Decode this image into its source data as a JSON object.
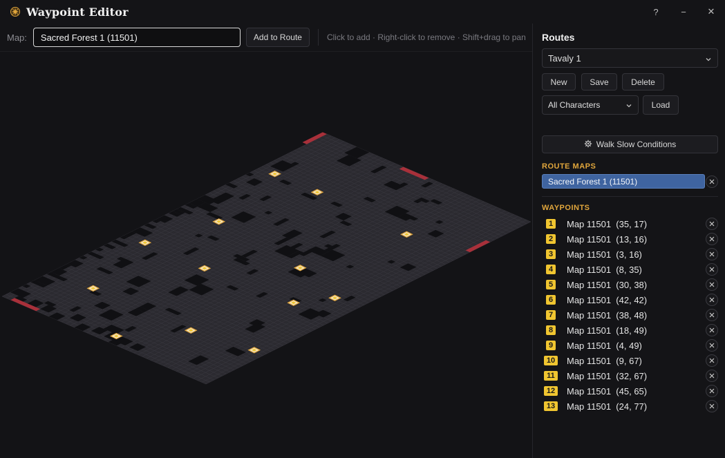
{
  "app": {
    "title": "Waypoint Editor"
  },
  "window": {
    "help": "?",
    "minimize": "−",
    "close": "✕"
  },
  "toolbar": {
    "map_label": "Map:",
    "map_value": "Sacred Forest 1 (11501)",
    "add_to_route": "Add to Route",
    "hint": "Click to add · Right-click to remove · Shift+drag to pan"
  },
  "routes": {
    "title": "Routes",
    "selected": "Tavaly 1",
    "new": "New",
    "save": "Save",
    "delete": "Delete",
    "character_filter": "All Characters",
    "load": "Load",
    "walk_slow": "Walk Slow Conditions"
  },
  "route_maps": {
    "title": "ROUTE MAPS",
    "items": [
      "Sacred Forest 1 (11501)"
    ]
  },
  "waypoints": {
    "title": "WAYPOINTS",
    "items": [
      {
        "n": "1",
        "label": "Map 11501  (35, 17)"
      },
      {
        "n": "2",
        "label": "Map 11501  (13, 16)"
      },
      {
        "n": "3",
        "label": "Map 11501  (3, 16)"
      },
      {
        "n": "4",
        "label": "Map 11501  (8, 35)"
      },
      {
        "n": "5",
        "label": "Map 11501  (30, 38)"
      },
      {
        "n": "6",
        "label": "Map 11501  (42, 42)"
      },
      {
        "n": "7",
        "label": "Map 11501  (38, 48)"
      },
      {
        "n": "8",
        "label": "Map 11501  (18, 49)"
      },
      {
        "n": "9",
        "label": "Map 11501  (4, 49)"
      },
      {
        "n": "10",
        "label": "Map 11501  (9, 67)"
      },
      {
        "n": "11",
        "label": "Map 11501  (32, 67)"
      },
      {
        "n": "12",
        "label": "Map 11501  (45, 65)"
      },
      {
        "n": "13",
        "label": "Map 11501  (24, 77)"
      }
    ]
  },
  "colors": {
    "accent": "#e1a63c",
    "badge": "#f0c530",
    "selected": "#3f64a0",
    "portal": "#a8303a",
    "tile": "#2b2a30",
    "blocked": "#101013"
  }
}
